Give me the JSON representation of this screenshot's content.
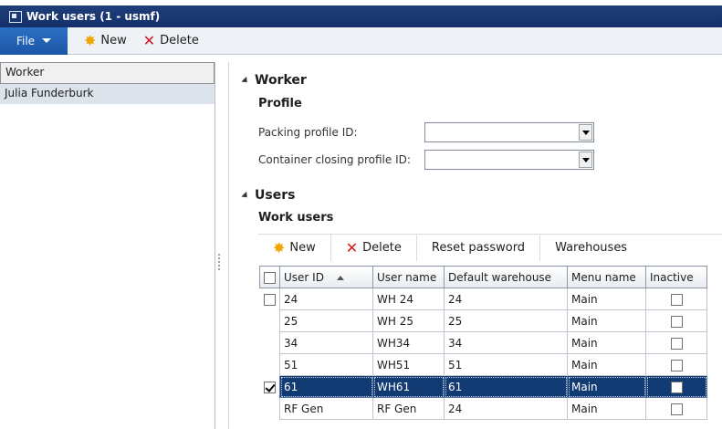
{
  "window": {
    "title": "Work users (1 - usmf)",
    "icon": "form-icon"
  },
  "menubar": {
    "file_label": "File",
    "new_label": "New",
    "delete_label": "Delete"
  },
  "left": {
    "header": "Worker",
    "items": [
      {
        "label": "Julia Funderburk"
      }
    ]
  },
  "worker_section": {
    "title": "Worker",
    "group": "Profile",
    "fields": [
      {
        "label": "Packing profile ID:",
        "value": ""
      },
      {
        "label": "Container closing profile ID:",
        "value": ""
      }
    ]
  },
  "users_section": {
    "title": "Users",
    "group": "Work users",
    "toolbar": {
      "new": "New",
      "delete": "Delete",
      "reset": "Reset password",
      "warehouses": "Warehouses"
    },
    "columns": [
      "User ID",
      "User name",
      "Default warehouse",
      "Menu name",
      "Inactive"
    ],
    "rows": [
      {
        "user_id": "24",
        "user_name": "WH 24",
        "warehouse": "24",
        "menu": "Main",
        "inactive": false,
        "row_checked": false,
        "selected": false
      },
      {
        "user_id": "25",
        "user_name": "WH 25",
        "warehouse": "25",
        "menu": "Main",
        "inactive": false,
        "row_checked": false,
        "selected": false
      },
      {
        "user_id": "34",
        "user_name": "WH34",
        "warehouse": "34",
        "menu": "Main",
        "inactive": false,
        "row_checked": false,
        "selected": false
      },
      {
        "user_id": "51",
        "user_name": "WH51",
        "warehouse": "51",
        "menu": "Main",
        "inactive": false,
        "row_checked": false,
        "selected": false
      },
      {
        "user_id": "61",
        "user_name": "WH61",
        "warehouse": "61",
        "menu": "Main",
        "inactive": false,
        "row_checked": true,
        "selected": true
      },
      {
        "user_id": "RF Gen",
        "user_name": "RF Gen",
        "warehouse": "24",
        "menu": "Main",
        "inactive": false,
        "row_checked": false,
        "selected": false
      }
    ]
  },
  "colors": {
    "titlebar": "#1f3f7a",
    "file_button": "#2b6fc4",
    "selected_row": "#123a73",
    "new_icon": "#f0a500",
    "delete_icon": "#d01a1a"
  }
}
